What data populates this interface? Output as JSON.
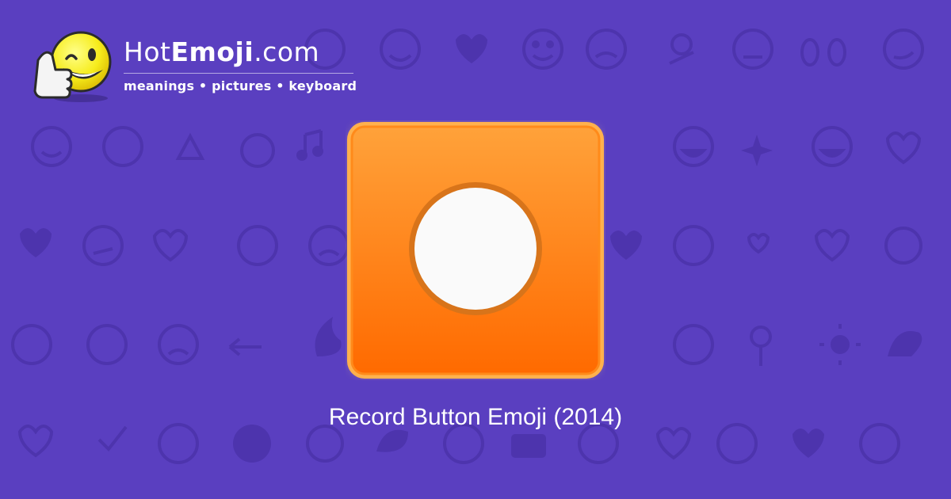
{
  "colors": {
    "background": "#5a3fc0",
    "pattern": "#4d34ad",
    "tile_top": "#ffa23a",
    "tile_bottom": "#ff6a00",
    "tile_glow": "#ffd36e",
    "disc": "#fafafa",
    "disc_ring": "#d8741a"
  },
  "logo": {
    "name_regular": "Hot",
    "name_bold": "Emoji",
    "name_suffix": ".com",
    "tagline": "meanings • pictures • keyboard",
    "mascot_icon": "winking-thumbs-up-smiley-icon"
  },
  "emoji": {
    "icon": "record-button-icon"
  },
  "caption": "Record Button Emoji (2014)"
}
